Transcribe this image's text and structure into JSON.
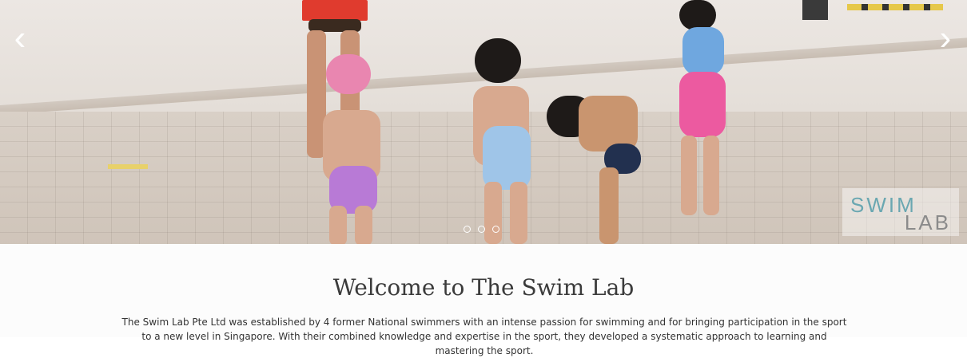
{
  "slider": {
    "prev_arrow": "‹",
    "next_arrow": "›",
    "dots": [
      "dot-1",
      "dot-2",
      "dot-3"
    ],
    "active_dot": 1
  },
  "logo": {
    "line1": "SWIM",
    "line2": "LAB"
  },
  "main": {
    "title": "Welcome to The Swim Lab",
    "intro": "The Swim Lab Pte Ltd was established by 4 former National swimmers with an intense passion for swimming and for bringing participation in the sport to a new level in Singapore. With their combined knowledge and expertise in the sport, they developed a systematic approach to learning and mastering the sport."
  },
  "colors": {
    "logo_teal": "#6aa7b1",
    "logo_grey": "#8b8b8b"
  }
}
